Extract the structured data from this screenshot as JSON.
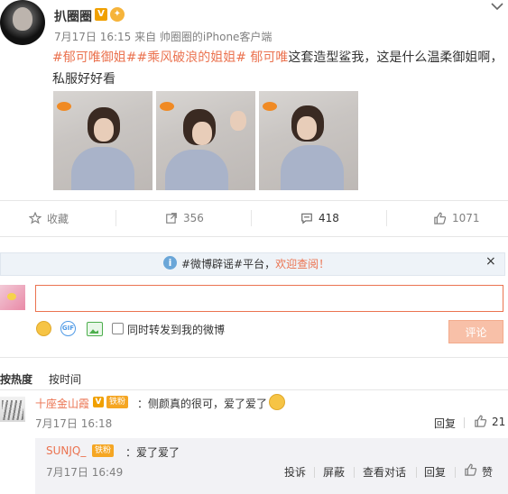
{
  "post": {
    "author": "扒圈圈",
    "verified_badge": "V",
    "meta": "7月17日 16:15 来自 帅圈圈的iPhone客户端",
    "hashtags": [
      "#郁可唯御姐#",
      "#乘风破浪的姐姐#"
    ],
    "mention": "郁可唯",
    "body": "这套造型鲨我，这是什么温柔御姐啊，私服好好看"
  },
  "actions": {
    "favorite_label": "收藏",
    "repost_count": "356",
    "comment_count": "418",
    "like_count": "1071"
  },
  "notice": {
    "prefix": "#微博辟谣#平台，",
    "link": "欢迎查阅！",
    "close": "×"
  },
  "composer": {
    "input_value": "",
    "forward_label": "同时转发到我的微博",
    "submit_label": "评论"
  },
  "sort": {
    "hot_label": "按热度",
    "time_label": "按时间"
  },
  "comments": [
    {
      "name": "十座金山霞",
      "fan_badge": "铁粉",
      "text": "：侧颜真的很可，爱了爱了",
      "time": "7月17日 16:18",
      "reply_label": "回复",
      "likes": "21"
    }
  ],
  "sub_reply": {
    "name": "SUNJQ_",
    "fan_badge": "铁粉",
    "text": "：爱了爱了",
    "time": "7月17日 16:49",
    "report_label": "投诉",
    "block_label": "屏蔽",
    "view_conversation_label": "查看对话",
    "reply_label": "回复",
    "like_label": "赞"
  },
  "colors": {
    "accent": "#eb7350",
    "link_blue": "#6aa6d8",
    "muted": "#808080"
  }
}
